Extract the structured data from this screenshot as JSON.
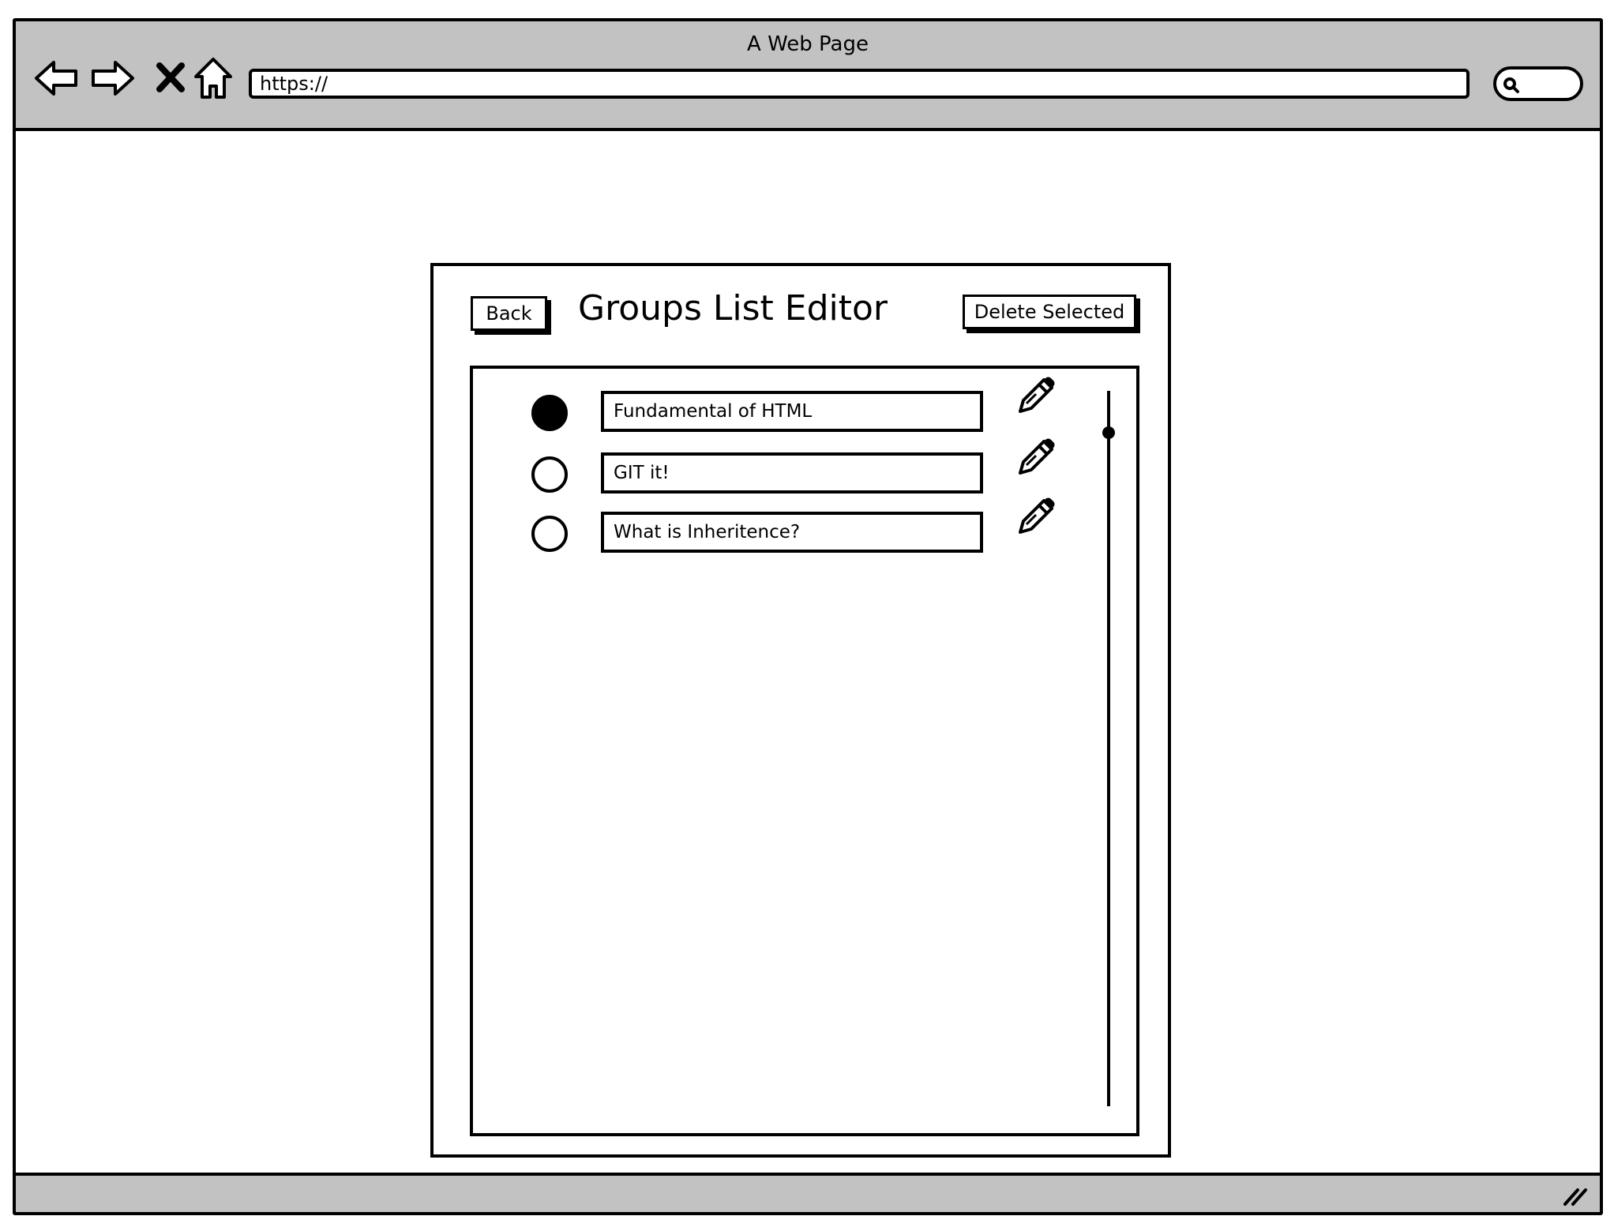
{
  "window": {
    "title": "A Web Page",
    "address": "https://"
  },
  "toolbar": {
    "icons": [
      "back-arrow-icon",
      "forward-arrow-icon",
      "close-x-icon",
      "home-icon",
      "search-icon",
      "resize-grip-icon"
    ]
  },
  "dialog": {
    "back_label": "Back",
    "title": "Groups List Editor",
    "delete_label": "Delete Selected"
  },
  "list": {
    "items": [
      {
        "label": "Fundamental of HTML",
        "selected": true
      },
      {
        "label": "GIT it!",
        "selected": false
      },
      {
        "label": "What is Inheritence?",
        "selected": false
      }
    ],
    "edit_icon": "pencil-icon"
  },
  "scrollbar": {
    "position": 0.04
  }
}
